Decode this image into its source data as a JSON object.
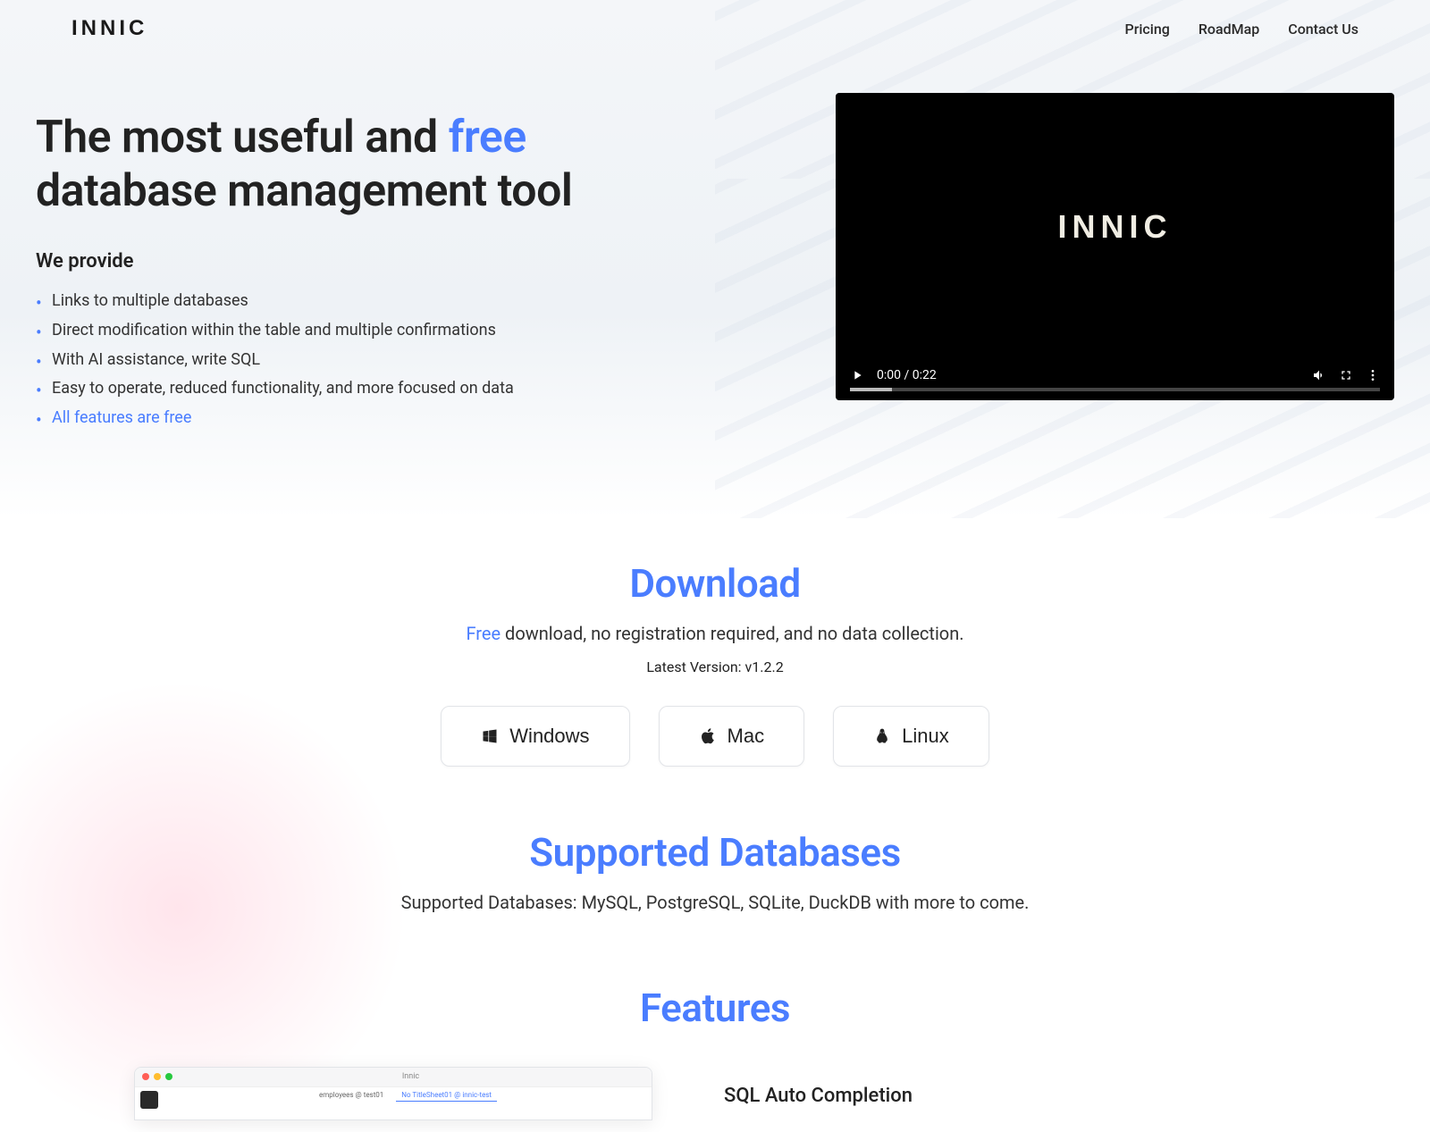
{
  "brand": "INNIC",
  "nav": {
    "pricing": "Pricing",
    "roadmap": "RoadMap",
    "contact": "Contact Us"
  },
  "hero": {
    "title_1": "The most useful and ",
    "title_accent": "free",
    "title_2": "database management tool",
    "we_provide": "We provide",
    "features": [
      "Links to multiple databases",
      "Direct modification within the table and multiple confirmations",
      "With AI assistance, write SQL",
      "Easy to operate, reduced functionality, and more focused on data",
      "All features are free"
    ]
  },
  "video": {
    "logo": "INNIC",
    "time": "0:00 / 0:22"
  },
  "download": {
    "title": "Download",
    "sub_accent": "Free",
    "sub_rest": " download, no registration required, and no data collection.",
    "version": "Latest Version: v1.2.2",
    "windows": "Windows",
    "mac": "Mac",
    "linux": "Linux"
  },
  "supported": {
    "title": "Supported Databases",
    "sub": "Supported Databases: MySQL, PostgreSQL, SQLite, DuckDB with more to come."
  },
  "features_section": {
    "title": "Features",
    "item1_title": "SQL Auto Completion",
    "screenshot": {
      "app_title": "Innic",
      "tab1": "employees @ test01",
      "tab2": "No TitleSheet01 @ innic-test"
    }
  }
}
